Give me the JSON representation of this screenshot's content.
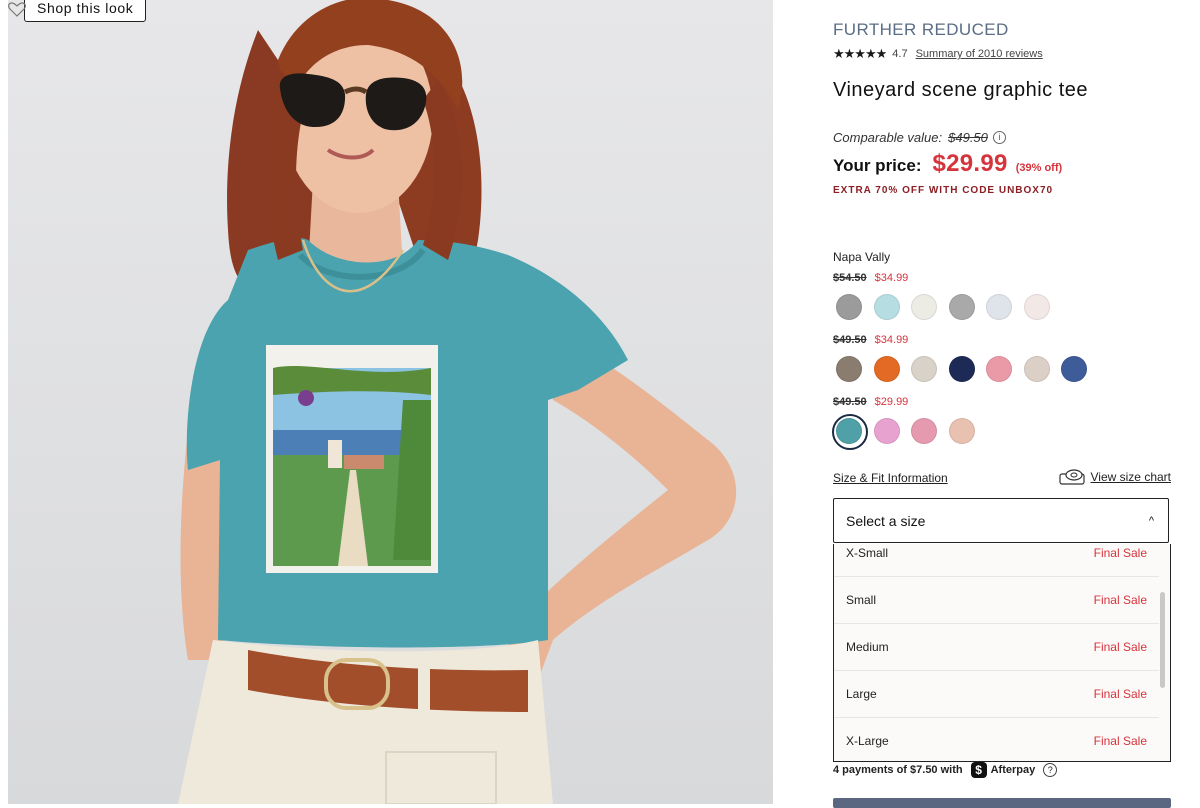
{
  "photo": {
    "shop_look_label": "Shop this look"
  },
  "product": {
    "promo_label": "FURTHER REDUCED",
    "rating": {
      "stars": "★★★★★",
      "value": "4.7",
      "summary_link": "Summary of 2010 reviews"
    },
    "title": "Vineyard scene graphic tee",
    "comparable_label": "Comparable value:",
    "comparable_price": "$49.50",
    "your_price_label": "Your price:",
    "your_price": "$29.99",
    "discount": "(39% off)",
    "extra_offer": "EXTRA 70% OFF WITH CODE UNBOX70"
  },
  "colors": {
    "selected_name": "Napa Vally",
    "groups": [
      {
        "old_price": "$54.50",
        "new_price": "$34.99",
        "swatches": [
          "#9b9b9b",
          "#b6dde2",
          "#ecebe4",
          "#a9a9a9",
          "#dfe3ea",
          "#f2e8e6"
        ]
      },
      {
        "old_price": "$49.50",
        "new_price": "$34.99",
        "swatches": [
          "#8a7d6f",
          "#e36a24",
          "#d9d2c8",
          "#1d2a55",
          "#ea9aa7",
          "#dccfc6",
          "#3e5c9a"
        ]
      },
      {
        "old_price": "$49.50",
        "new_price": "$29.99",
        "swatches": [
          "#4fa0a7",
          "#e8a2cf",
          "#e59ab0",
          "#e9c1b0"
        ]
      }
    ]
  },
  "size": {
    "fit_info_link": "Size & Fit Information",
    "size_chart_link": "View size chart",
    "select_placeholder": "Select a size",
    "options": [
      {
        "label": "X-Small",
        "status": "Final Sale"
      },
      {
        "label": "Small",
        "status": "Final Sale"
      },
      {
        "label": "Medium",
        "status": "Final Sale"
      },
      {
        "label": "Large",
        "status": "Final Sale"
      },
      {
        "label": "X-Large",
        "status": "Final Sale"
      }
    ]
  },
  "afterpay": {
    "text": "4 payments of $7.50 with",
    "brand": "Afterpay"
  },
  "colors_theme": {
    "sale_red": "#d6343c",
    "promo_blue": "#5b6d84",
    "navy": "#1b2b44"
  }
}
